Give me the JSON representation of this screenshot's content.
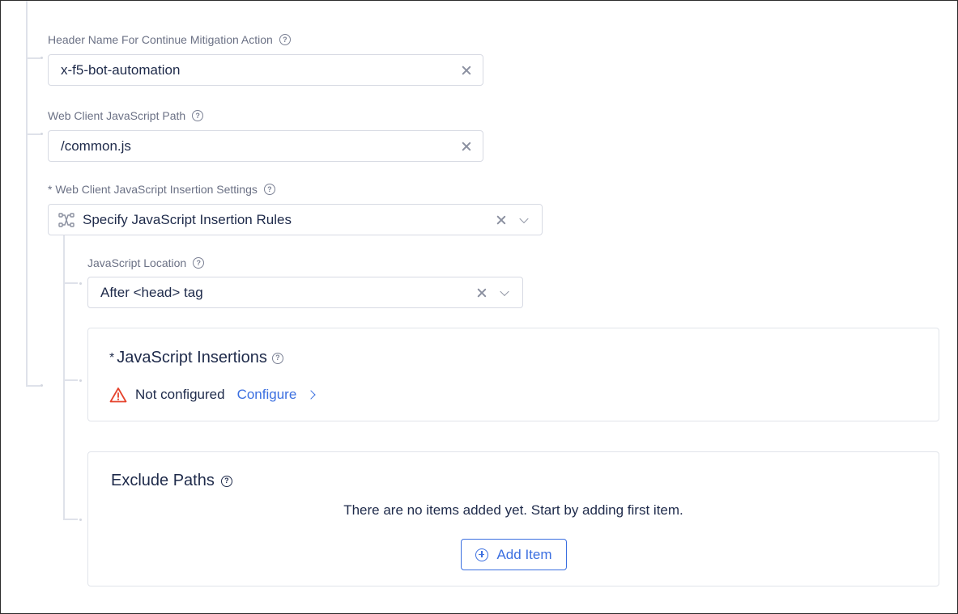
{
  "fields": {
    "header_name": {
      "label": "Header Name For Continue Mitigation Action",
      "value": "x-f5-bot-automation"
    },
    "js_path": {
      "label": "Web Client JavaScript Path",
      "value": "/common.js"
    },
    "insertion_settings": {
      "label": "* Web Client JavaScript Insertion Settings",
      "value": "Specify JavaScript Insertion Rules",
      "icon": "flow-diagram-icon"
    },
    "js_location": {
      "label": "JavaScript Location",
      "value": "After <head> tag"
    }
  },
  "insertions_panel": {
    "required_mark": "*",
    "title": "JavaScript Insertions",
    "status_text": "Not configured",
    "configure_label": "Configure",
    "warning_color": "#e5432d"
  },
  "exclude_paths_panel": {
    "title": "Exclude Paths",
    "empty_message": "There are no items added yet. Start by adding first item.",
    "add_button_label": "Add Item"
  },
  "colors": {
    "accent": "#3b6fe0",
    "text": "#1e2a4a",
    "label": "#6b7185",
    "border": "#d7dae3"
  }
}
